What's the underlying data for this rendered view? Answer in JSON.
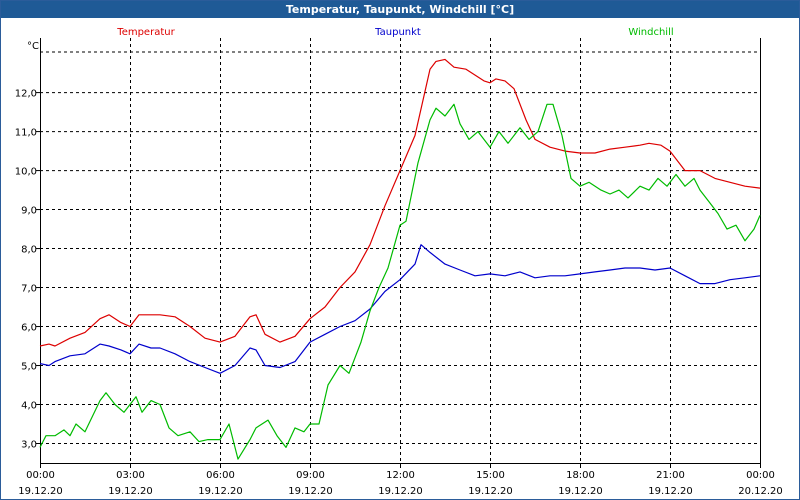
{
  "window": {
    "title": "Temperatur, Taupunkt, Windchill [°C]"
  },
  "chart_data": {
    "type": "line",
    "title": "Temperatur, Taupunkt, Windchill [°C]",
    "ylabel": "°C",
    "xlabel": "",
    "ylim": [
      2.5,
      13.4
    ],
    "yticks": [
      3.0,
      4.0,
      5.0,
      6.0,
      7.0,
      8.0,
      9.0,
      10.0,
      11.0,
      12.0
    ],
    "ytick_labels": [
      "3,0",
      "4,0",
      "5,0",
      "6,0",
      "7,0",
      "8,0",
      "9,0",
      "10,0",
      "11,0",
      "12,0"
    ],
    "xlim": [
      0,
      24
    ],
    "xticks": [
      {
        "x": 0,
        "time": "00:00",
        "date": "19.12.20"
      },
      {
        "x": 3,
        "time": "03:00",
        "date": "19.12.20"
      },
      {
        "x": 6,
        "time": "06:00",
        "date": "19.12.20"
      },
      {
        "x": 9,
        "time": "09:00",
        "date": "19.12.20"
      },
      {
        "x": 12,
        "time": "12:00",
        "date": "19.12.20"
      },
      {
        "x": 15,
        "time": "15:00",
        "date": "19.12.20"
      },
      {
        "x": 18,
        "time": "18:00",
        "date": "19.12.20"
      },
      {
        "x": 21,
        "time": "21:00",
        "date": "19.12.20"
      },
      {
        "x": 24,
        "time": "00:00",
        "date": "20.12.20"
      }
    ],
    "grid": true,
    "legend_position": "top",
    "series": [
      {
        "name": "Temperatur",
        "color": "#dd0000",
        "points": [
          [
            0,
            5.5
          ],
          [
            0.3,
            5.55
          ],
          [
            0.5,
            5.5
          ],
          [
            1,
            5.7
          ],
          [
            1.5,
            5.85
          ],
          [
            2,
            6.2
          ],
          [
            2.3,
            6.3
          ],
          [
            2.7,
            6.1
          ],
          [
            3,
            6.0
          ],
          [
            3.3,
            6.3
          ],
          [
            3.7,
            6.3
          ],
          [
            4,
            6.3
          ],
          [
            4.5,
            6.25
          ],
          [
            5,
            6.0
          ],
          [
            5.5,
            5.7
          ],
          [
            6,
            5.6
          ],
          [
            6.5,
            5.75
          ],
          [
            7,
            6.25
          ],
          [
            7.2,
            6.3
          ],
          [
            7.5,
            5.8
          ],
          [
            8,
            5.6
          ],
          [
            8.5,
            5.75
          ],
          [
            9,
            6.2
          ],
          [
            9.5,
            6.5
          ],
          [
            10,
            7.0
          ],
          [
            10.5,
            7.4
          ],
          [
            11,
            8.1
          ],
          [
            11.5,
            9.1
          ],
          [
            12,
            10.0
          ],
          [
            12.5,
            10.9
          ],
          [
            13,
            12.6
          ],
          [
            13.2,
            12.8
          ],
          [
            13.5,
            12.85
          ],
          [
            13.8,
            12.65
          ],
          [
            14.2,
            12.6
          ],
          [
            14.8,
            12.3
          ],
          [
            15,
            12.25
          ],
          [
            15.2,
            12.35
          ],
          [
            15.5,
            12.3
          ],
          [
            15.8,
            12.1
          ],
          [
            16.2,
            11.3
          ],
          [
            16.5,
            10.8
          ],
          [
            17,
            10.6
          ],
          [
            17.5,
            10.5
          ],
          [
            18,
            10.45
          ],
          [
            18.5,
            10.45
          ],
          [
            19,
            10.55
          ],
          [
            19.5,
            10.6
          ],
          [
            20,
            10.65
          ],
          [
            20.3,
            10.7
          ],
          [
            20.7,
            10.65
          ],
          [
            21,
            10.5
          ],
          [
            21.5,
            10.0
          ],
          [
            22,
            10.0
          ],
          [
            22.5,
            9.8
          ],
          [
            23,
            9.7
          ],
          [
            23.5,
            9.6
          ],
          [
            24,
            9.55
          ]
        ]
      },
      {
        "name": "Taupunkt",
        "color": "#0000cc",
        "points": [
          [
            0,
            5.05
          ],
          [
            0.3,
            5.0
          ],
          [
            0.5,
            5.1
          ],
          [
            1,
            5.25
          ],
          [
            1.5,
            5.3
          ],
          [
            2,
            5.55
          ],
          [
            2.3,
            5.5
          ],
          [
            2.7,
            5.4
          ],
          [
            3,
            5.3
          ],
          [
            3.3,
            5.55
          ],
          [
            3.7,
            5.45
          ],
          [
            4,
            5.45
          ],
          [
            4.5,
            5.3
          ],
          [
            5,
            5.1
          ],
          [
            5.5,
            4.95
          ],
          [
            6,
            4.8
          ],
          [
            6.5,
            5.0
          ],
          [
            7,
            5.45
          ],
          [
            7.2,
            5.4
          ],
          [
            7.5,
            5.0
          ],
          [
            8,
            4.95
          ],
          [
            8.5,
            5.1
          ],
          [
            9,
            5.6
          ],
          [
            9.5,
            5.8
          ],
          [
            10,
            6.0
          ],
          [
            10.5,
            6.15
          ],
          [
            11,
            6.45
          ],
          [
            11.5,
            6.9
          ],
          [
            12,
            7.2
          ],
          [
            12.5,
            7.6
          ],
          [
            12.7,
            8.1
          ],
          [
            13,
            7.9
          ],
          [
            13.5,
            7.6
          ],
          [
            14,
            7.45
          ],
          [
            14.5,
            7.3
          ],
          [
            15,
            7.35
          ],
          [
            15.5,
            7.3
          ],
          [
            16,
            7.4
          ],
          [
            16.5,
            7.25
          ],
          [
            17,
            7.3
          ],
          [
            17.5,
            7.3
          ],
          [
            18,
            7.35
          ],
          [
            18.5,
            7.4
          ],
          [
            19,
            7.45
          ],
          [
            19.5,
            7.5
          ],
          [
            20,
            7.5
          ],
          [
            20.5,
            7.45
          ],
          [
            21,
            7.5
          ],
          [
            21.5,
            7.3
          ],
          [
            22,
            7.1
          ],
          [
            22.5,
            7.1
          ],
          [
            23,
            7.2
          ],
          [
            23.5,
            7.25
          ],
          [
            24,
            7.3
          ]
        ]
      },
      {
        "name": "Windchill",
        "color": "#00bb00",
        "points": [
          [
            0,
            2.9
          ],
          [
            0.2,
            3.2
          ],
          [
            0.5,
            3.2
          ],
          [
            0.8,
            3.35
          ],
          [
            1,
            3.2
          ],
          [
            1.2,
            3.5
          ],
          [
            1.5,
            3.3
          ],
          [
            2,
            4.1
          ],
          [
            2.2,
            4.3
          ],
          [
            2.5,
            4.0
          ],
          [
            2.8,
            3.8
          ],
          [
            3,
            4.0
          ],
          [
            3.2,
            4.2
          ],
          [
            3.4,
            3.8
          ],
          [
            3.7,
            4.1
          ],
          [
            4,
            4.0
          ],
          [
            4.3,
            3.4
          ],
          [
            4.6,
            3.2
          ],
          [
            5,
            3.3
          ],
          [
            5.3,
            3.05
          ],
          [
            5.6,
            3.1
          ],
          [
            6,
            3.1
          ],
          [
            6.3,
            3.5
          ],
          [
            6.6,
            2.6
          ],
          [
            7,
            3.1
          ],
          [
            7.2,
            3.4
          ],
          [
            7.6,
            3.6
          ],
          [
            7.9,
            3.2
          ],
          [
            8.2,
            2.9
          ],
          [
            8.5,
            3.4
          ],
          [
            8.8,
            3.3
          ],
          [
            9,
            3.5
          ],
          [
            9.3,
            3.5
          ],
          [
            9.6,
            4.5
          ],
          [
            10,
            5.0
          ],
          [
            10.3,
            4.8
          ],
          [
            10.7,
            5.6
          ],
          [
            11,
            6.4
          ],
          [
            11.3,
            7.0
          ],
          [
            11.6,
            7.5
          ],
          [
            12,
            8.6
          ],
          [
            12.2,
            8.7
          ],
          [
            12.6,
            10.2
          ],
          [
            13,
            11.3
          ],
          [
            13.2,
            11.6
          ],
          [
            13.5,
            11.4
          ],
          [
            13.8,
            11.7
          ],
          [
            14,
            11.2
          ],
          [
            14.3,
            10.8
          ],
          [
            14.6,
            11.0
          ],
          [
            15,
            10.6
          ],
          [
            15.3,
            11.0
          ],
          [
            15.6,
            10.7
          ],
          [
            16,
            11.1
          ],
          [
            16.3,
            10.8
          ],
          [
            16.6,
            11.0
          ],
          [
            16.9,
            11.7
          ],
          [
            17.1,
            11.7
          ],
          [
            17.4,
            10.9
          ],
          [
            17.7,
            9.8
          ],
          [
            18,
            9.6
          ],
          [
            18.3,
            9.7
          ],
          [
            18.7,
            9.5
          ],
          [
            19,
            9.4
          ],
          [
            19.3,
            9.5
          ],
          [
            19.6,
            9.3
          ],
          [
            20,
            9.6
          ],
          [
            20.3,
            9.5
          ],
          [
            20.6,
            9.8
          ],
          [
            20.9,
            9.6
          ],
          [
            21.2,
            9.9
          ],
          [
            21.5,
            9.6
          ],
          [
            21.8,
            9.8
          ],
          [
            22,
            9.5
          ],
          [
            22.3,
            9.2
          ],
          [
            22.6,
            8.9
          ],
          [
            22.9,
            8.5
          ],
          [
            23.2,
            8.6
          ],
          [
            23.5,
            8.2
          ],
          [
            23.8,
            8.5
          ],
          [
            24,
            8.85
          ]
        ]
      }
    ]
  }
}
